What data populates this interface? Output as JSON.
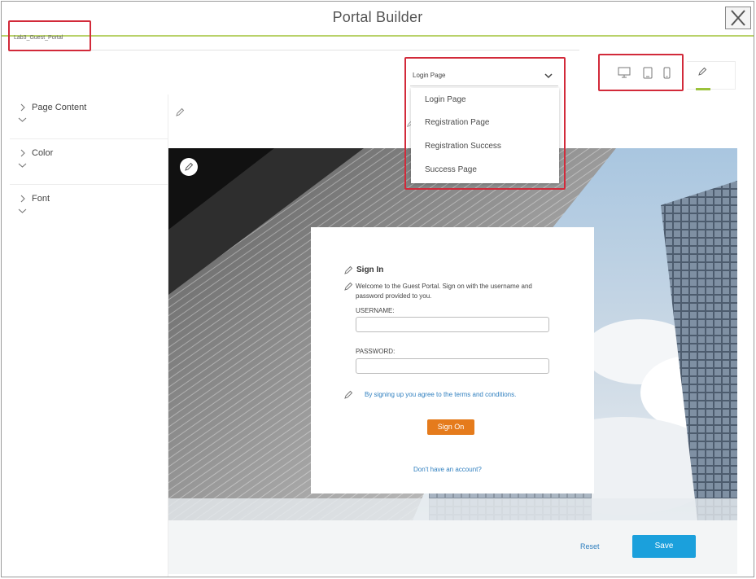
{
  "window": {
    "title": "Portal Builder"
  },
  "toolbar": {
    "portal_name": "Lab3_Guest_Portal",
    "page_select": {
      "selected": "Login Page",
      "options": [
        "Login Page",
        "Registration Page",
        "Registration Success",
        "Success Page"
      ]
    },
    "devices": [
      "desktop-icon",
      "tablet-icon",
      "phone-icon"
    ]
  },
  "sidebar": {
    "sections": [
      {
        "label": "Page Content"
      },
      {
        "label": "Color"
      },
      {
        "label": "Font"
      }
    ]
  },
  "login_card": {
    "title": "Sign In",
    "welcome": "Welcome to the Guest Portal. Sign on with the username and password provided to you.",
    "username_label": "USERNAME:",
    "password_label": "PASSWORD:",
    "terms": "By signing up you agree to the terms and conditions.",
    "sign_on": "Sign On",
    "no_account": "Don't have an account?"
  },
  "footer": {
    "reset": "Reset",
    "save": "Save"
  },
  "colors": {
    "accent_green": "#9bc23b",
    "highlight_red": "#d22a3a",
    "sign_on_orange": "#e57b1c",
    "save_blue": "#1ba0dc",
    "link_blue": "#2f7fbf"
  }
}
